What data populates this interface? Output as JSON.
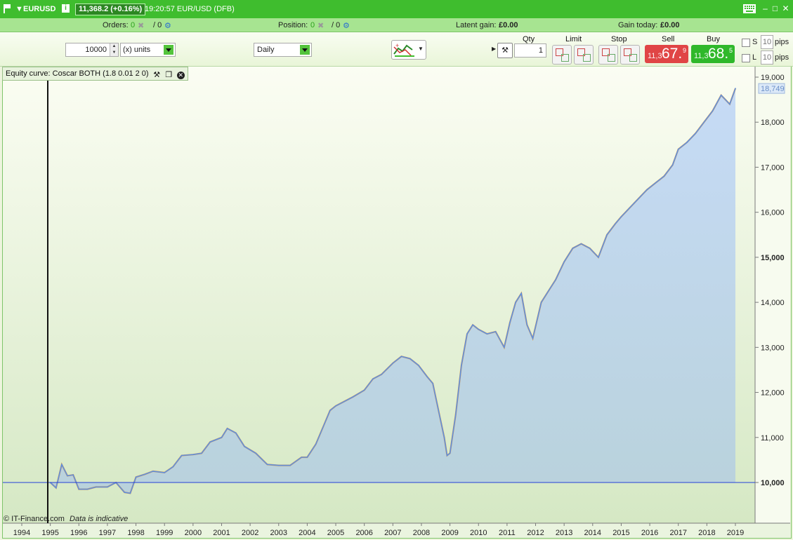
{
  "title_bar": {
    "instrument": "EURUSD",
    "info_icon": "i",
    "price": "11,368.2 (+0.16%)",
    "time_label": "19:20:57 EUR/USD (DFB)",
    "keyboard_icon": "keyboard-icon",
    "minimize_icon": "minimize-icon",
    "maximize_icon": "maximize-icon",
    "close_icon": "close-icon"
  },
  "orders_bar": {
    "orders_label": "Orders:",
    "orders_count": "0",
    "orders_total": "/ 0",
    "position_label": "Position:",
    "position_count": "0",
    "position_total": "/ 0",
    "latent_label": "Latent gain:",
    "latent_value": "£0.00",
    "gain_today_label": "Gain today:",
    "gain_today_value": "£0.00"
  },
  "ticket": {
    "size_value": "10000",
    "size_unit": "(x) units",
    "timeframe": "Daily",
    "qty_label": "Qty",
    "qty_value": "1",
    "limit_label": "Limit",
    "stop_label": "Stop",
    "sell_label": "Sell",
    "sell_prefix": "11,3",
    "sell_main": "67.",
    "sell_sup": "9",
    "buy_label": "Buy",
    "buy_prefix": "11,3",
    "buy_main": "68.",
    "buy_sup": "5",
    "s_label": "S",
    "l_label": "L",
    "s_pips": "10",
    "l_pips": "10",
    "pips_label": "pips"
  },
  "chart_header": {
    "label": "Equity curve: Coscar BOTH (1.8 0.01 2 0)"
  },
  "footer": {
    "copyright": "© IT-Finance.com",
    "note": "Data is indicative"
  },
  "colors": {
    "title_green": "#3fbd2e",
    "equity_line": "#5b8fe6",
    "drawdown_line": "#f5a02a",
    "baseline": "#2340d8"
  },
  "chart_data": {
    "type": "area",
    "y_ticks": [
      "19,000",
      "18,000",
      "17,000",
      "16,000",
      "15,000",
      "14,000",
      "13,000",
      "12,000",
      "11,000",
      "10,000"
    ],
    "y_major": [
      "15,000",
      "10,000"
    ],
    "ylim": [
      9150,
      19350
    ],
    "baseline": 10000,
    "last_value_label": "18,749",
    "x_ticks": [
      "1994",
      "1995",
      "1996",
      "1997",
      "1998",
      "1999",
      "2000",
      "2001",
      "2002",
      "2003",
      "2004",
      "2005",
      "2006",
      "2007",
      "2008",
      "2009",
      "2010",
      "2011",
      "2012",
      "2013",
      "2014",
      "2015",
      "2016",
      "2017",
      "2018",
      "2019"
    ],
    "x": [
      1995.0,
      1995.2,
      1995.4,
      1995.6,
      1995.8,
      1996.0,
      1996.3,
      1996.6,
      1997.0,
      1997.3,
      1997.6,
      1997.8,
      1998.0,
      1998.3,
      1998.6,
      1999.0,
      1999.3,
      1999.6,
      2000.0,
      2000.3,
      2000.6,
      2001.0,
      2001.2,
      2001.5,
      2001.8,
      2002.2,
      2002.6,
      2003.0,
      2003.4,
      2003.8,
      2004.0,
      2004.3,
      2004.6,
      2004.8,
      2005.0,
      2005.3,
      2005.6,
      2006.0,
      2006.3,
      2006.6,
      2007.0,
      2007.3,
      2007.6,
      2007.9,
      2008.2,
      2008.4,
      2008.6,
      2008.8,
      2008.9,
      2009.0,
      2009.2,
      2009.4,
      2009.6,
      2009.8,
      2010.0,
      2010.3,
      2010.6,
      2010.9,
      2011.1,
      2011.3,
      2011.5,
      2011.7,
      2011.9,
      2012.2,
      2012.5,
      2012.7,
      2013.0,
      2013.3,
      2013.6,
      2013.9,
      2014.2,
      2014.5,
      2014.8,
      2015.0,
      2015.3,
      2015.6,
      2015.9,
      2016.2,
      2016.5,
      2016.8,
      2017.0,
      2017.3,
      2017.6,
      2017.9,
      2018.2,
      2018.5,
      2018.8,
      2019.0
    ],
    "series": [
      {
        "values": [
          10000,
          9880,
          10400,
          10150,
          10170,
          9850,
          9850,
          9900,
          9900,
          10000,
          9780,
          9760,
          10120,
          10180,
          10250,
          10220,
          10350,
          10600,
          10620,
          10650,
          10900,
          11000,
          11200,
          11100,
          10800,
          10650,
          10400,
          10380,
          10380,
          10560,
          10560,
          10850,
          11300,
          11600,
          11700,
          11800,
          11900,
          12050,
          12300,
          12400,
          12650,
          12800,
          12750,
          12600,
          12350,
          12200,
          11600,
          11000,
          10600,
          10650,
          11500,
          12600,
          13300,
          13500,
          13400,
          13300,
          13350,
          13000,
          13550,
          14000,
          14200,
          13500,
          13200,
          14000,
          14300,
          14500,
          14900,
          15200,
          15300,
          15200,
          15000,
          15500,
          15750,
          15900,
          16100,
          16300,
          16500,
          16650,
          16800,
          17050,
          17400,
          17550,
          17750,
          18000,
          18250,
          18600,
          18400,
          18750
        ]
      }
    ]
  }
}
